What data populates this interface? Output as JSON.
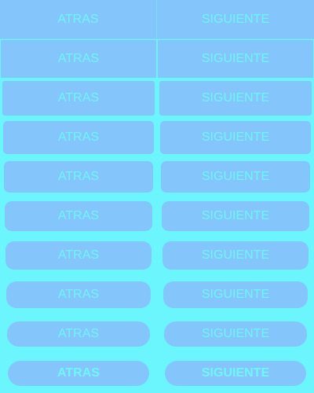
{
  "buttons": {
    "back_label": "ATRAS",
    "next_label": "SIGUIENTE"
  },
  "rows": [
    {
      "back": "ATRAS",
      "next": "SIGUIENTE"
    },
    {
      "back": "ATRAS",
      "next": "SIGUIENTE"
    },
    {
      "back": "ATRAS",
      "next": "SIGUIENTE"
    },
    {
      "back": "ATRAS",
      "next": "SIGUIENTE"
    },
    {
      "back": "ATRAS",
      "next": "SIGUIENTE"
    },
    {
      "back": "ATRAS",
      "next": "SIGUIENTE"
    },
    {
      "back": "ATRAS",
      "next": "SIGUIENTE"
    },
    {
      "back": "ATRAS",
      "next": "SIGUIENTE"
    },
    {
      "back": "ATRAS",
      "next": "SIGUIENTE"
    },
    {
      "back": "ATRAS",
      "next": "SIGUIENTE"
    }
  ],
  "colors": {
    "background": "#6cf5fc",
    "button_fill": "#84c6fb",
    "label_text": "#6ef5fb"
  }
}
